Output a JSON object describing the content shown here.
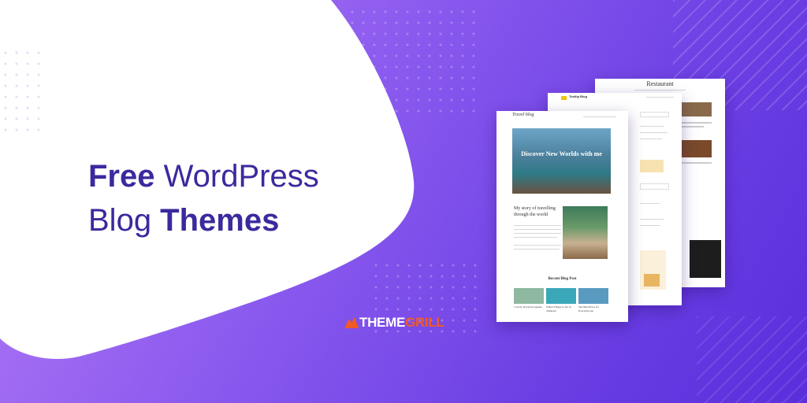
{
  "headline": {
    "line1_bold": "Free",
    "line1_light": " WordPress",
    "line2_light": "Blog ",
    "line2_bold": "Themes"
  },
  "logo": {
    "part1": "THEME",
    "part2": "GRILL"
  },
  "mockups": {
    "back": {
      "title": "Restaurant"
    },
    "mid": {
      "site": "Tooltip Blog"
    },
    "front": {
      "site": "Travel blog",
      "hero": "Discover New Worlds with me",
      "story": "My story of travelling through the world",
      "recent": "Recent Blog Post",
      "posts": [
        "5 Great Travel Escapades",
        "8 Best Things to Do in Thailand",
        "The Best Place for Everyday use"
      ]
    }
  },
  "colors": {
    "headline": "#3a2a9e",
    "logo_grill": "#f15a24",
    "bg_from": "#b77ef5",
    "bg_to": "#5a2fdc"
  }
}
